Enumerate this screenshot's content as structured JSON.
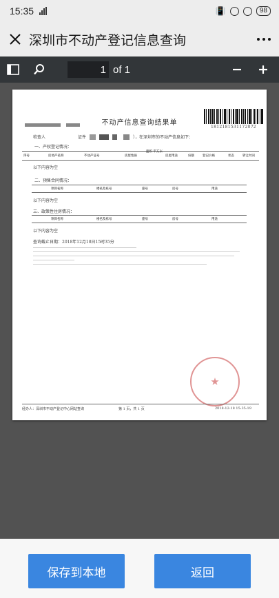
{
  "status": {
    "time": "15:35",
    "battery": "98"
  },
  "header": {
    "title": "深圳市不动产登记信息查询"
  },
  "viewer": {
    "page_current": "1",
    "page_of": "of 1"
  },
  "document": {
    "title": "不动产信息查询结果单",
    "barcode_number": "1812181531172072",
    "query_person_label": "检查人",
    "id_label": "证件",
    "intro": "），在深圳市的不动产信息如下：",
    "section1": "一、产权登记情况：",
    "table1_headers": [
      "序号",
      "房地产名称",
      "不动产证号",
      "房屋性质",
      "面积 平方米",
      "房屋用途",
      "份额",
      "登记价格",
      "状态",
      "转让时间"
    ],
    "empty_text": "以下内容为空",
    "section2": "二、预售合同情况：",
    "table2_headers": [
      "项目名称",
      "楼名及栋号",
      "座号",
      "房号",
      "用途"
    ],
    "section3": "三、政策性住房情况：",
    "table3_headers": [
      "项目名称",
      "楼名及栋号",
      "座号",
      "房号",
      "用途"
    ],
    "deadline": "查询截止日期：2018年12月18日15时35分",
    "footer_left": "经办人：深圳市不动产登记中心网站查询",
    "footer_mid": "第 1 页，共 1 页",
    "footer_right": "2018-12-18 15:35:19"
  },
  "actions": {
    "save": "保存到本地",
    "back": "返回"
  }
}
